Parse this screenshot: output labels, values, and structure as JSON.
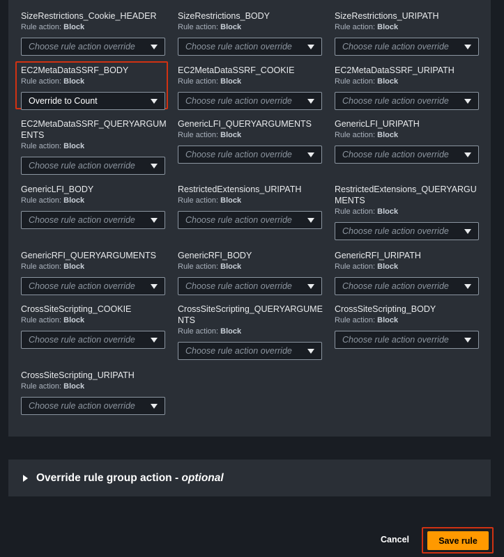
{
  "rule_action_label": "Rule action:",
  "placeholder": "Choose rule action override",
  "rules": [
    {
      "name": "SizeRestrictions_Cookie_HEADER",
      "action": "Block",
      "override": ""
    },
    {
      "name": "SizeRestrictions_BODY",
      "action": "Block",
      "override": ""
    },
    {
      "name": "SizeRestrictions_URIPATH",
      "action": "Block",
      "override": ""
    },
    {
      "name": "EC2MetaDataSSRF_BODY",
      "action": "Block",
      "override": "Override to Count"
    },
    {
      "name": "EC2MetaDataSSRF_COOKIE",
      "action": "Block",
      "override": ""
    },
    {
      "name": "EC2MetaDataSSRF_URIPATH",
      "action": "Block",
      "override": ""
    },
    {
      "name": "EC2MetaDataSSRF_QUERYARGUMENTS",
      "action": "Block",
      "override": ""
    },
    {
      "name": "GenericLFI_QUERYARGUMENTS",
      "action": "Block",
      "override": ""
    },
    {
      "name": "GenericLFI_URIPATH",
      "action": "Block",
      "override": ""
    },
    {
      "name": "GenericLFI_BODY",
      "action": "Block",
      "override": ""
    },
    {
      "name": "RestrictedExtensions_URIPATH",
      "action": "Block",
      "override": ""
    },
    {
      "name": "RestrictedExtensions_QUERYARGUMENTS",
      "action": "Block",
      "override": ""
    },
    {
      "name": "GenericRFI_QUERYARGUMENTS",
      "action": "Block",
      "override": ""
    },
    {
      "name": "GenericRFI_BODY",
      "action": "Block",
      "override": ""
    },
    {
      "name": "GenericRFI_URIPATH",
      "action": "Block",
      "override": ""
    },
    {
      "name": "CrossSiteScripting_COOKIE",
      "action": "Block",
      "override": ""
    },
    {
      "name": "CrossSiteScripting_QUERYARGUMENTS",
      "action": "Block",
      "override": ""
    },
    {
      "name": "CrossSiteScripting_BODY",
      "action": "Block",
      "override": ""
    },
    {
      "name": "CrossSiteScripting_URIPATH",
      "action": "Block",
      "override": ""
    }
  ],
  "override_section": {
    "title": "Override rule group action - ",
    "optional": "optional"
  },
  "footer": {
    "cancel_label": "Cancel",
    "save_label": "Save rule"
  }
}
